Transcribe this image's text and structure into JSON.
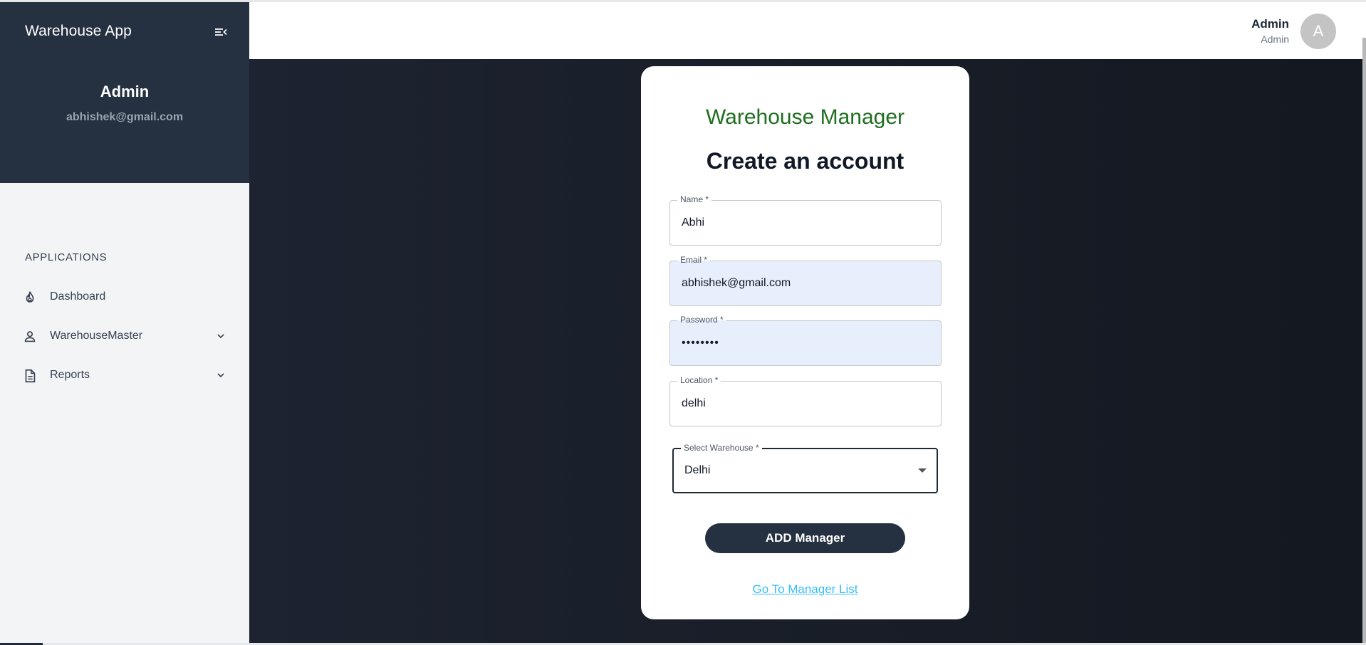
{
  "sidebar": {
    "app_title": "Warehouse App",
    "profile_name": "Admin",
    "profile_email": "abhishek@gmail.com",
    "section_label": "APPLICATIONS",
    "items": [
      {
        "label": "Dashboard",
        "icon": "fire-icon"
      },
      {
        "label": "WarehouseMaster",
        "icon": "person-icon"
      },
      {
        "label": "Reports",
        "icon": "document-icon"
      }
    ]
  },
  "header": {
    "user_name": "Admin",
    "user_role": "Admin",
    "avatar_letter": "A"
  },
  "form": {
    "brand": "Warehouse Manager",
    "title": "Create an account",
    "fields": [
      {
        "label": "Name *",
        "value": "Abhi"
      },
      {
        "label": "Email *",
        "value": "abhishek@gmail.com"
      },
      {
        "label": "Password *",
        "value": "••••••••"
      },
      {
        "label": "Location *",
        "value": "delhi"
      },
      {
        "label": "Select Warehouse *",
        "value": "Delhi"
      }
    ],
    "submit_label": "ADD Manager",
    "list_link": "Go To Manager List"
  },
  "colors": {
    "sidebar_header": "#253040",
    "brand_green": "#1f6e20",
    "button": "#253040",
    "link": "#38bdf8",
    "autofill_bg": "#e8effc"
  }
}
